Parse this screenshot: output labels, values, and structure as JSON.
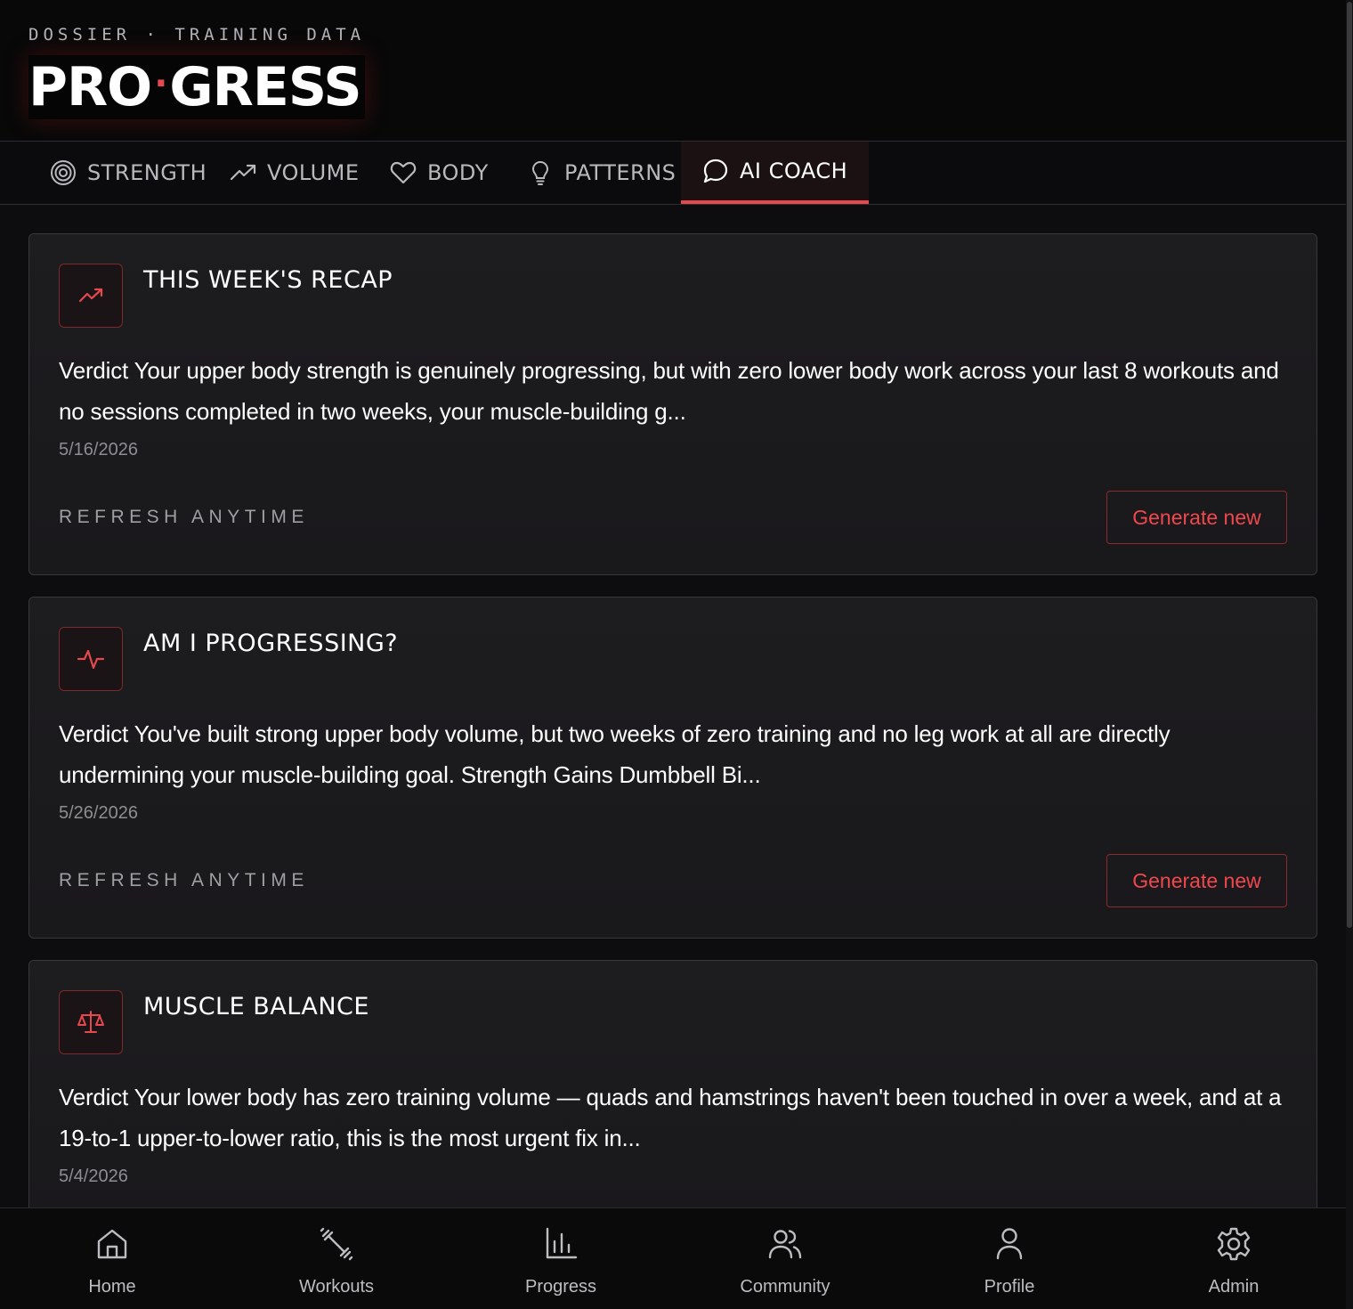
{
  "header": {
    "eyebrow": "DOSSIER · TRAINING DATA",
    "brand_left": "PRO",
    "brand_dot": "·",
    "brand_right": "GRESS"
  },
  "tabs": [
    {
      "label": "STRENGTH",
      "icon": "target-icon"
    },
    {
      "label": "VOLUME",
      "icon": "trending-up-icon"
    },
    {
      "label": "BODY",
      "icon": "heart-icon"
    },
    {
      "label": "PATTERNS",
      "icon": "lightbulb-icon"
    },
    {
      "label": "AI COACH",
      "icon": "chat-bubble-icon",
      "active": true
    }
  ],
  "cards": [
    {
      "title": "THIS WEEK'S RECAP",
      "icon": "trending-up-icon",
      "body": "Verdict Your upper body strength is genuinely progressing, but with zero lower body work across your last 8 workouts and no sessions completed in two weeks, your muscle-building g...",
      "date": "5/16/2026",
      "footer": "REFRESH ANYTIME",
      "button": "Generate new"
    },
    {
      "title": "AM I PROGRESSING?",
      "icon": "activity-pulse-icon",
      "body": "Verdict You've built strong upper body volume, but two weeks of zero training and no leg work at all are directly undermining your muscle-building goal. Strength Gains Dumbbell Bi...",
      "date": "5/26/2026",
      "footer": "REFRESH ANYTIME",
      "button": "Generate new"
    },
    {
      "title": "MUSCLE BALANCE",
      "icon": "scale-icon",
      "body": "Verdict Your lower body has zero training volume — quads and hamstrings haven't been touched in over a week, and at a 19-to-1 upper-to-lower ratio, this is the most urgent fix in...",
      "date": "5/4/2026"
    }
  ],
  "bottom_nav": [
    {
      "label": "Home",
      "icon": "home-icon"
    },
    {
      "label": "Workouts",
      "icon": "dumbbell-icon"
    },
    {
      "label": "Progress",
      "icon": "bar-chart-icon"
    },
    {
      "label": "Community",
      "icon": "users-icon"
    },
    {
      "label": "Profile",
      "icon": "user-icon"
    },
    {
      "label": "Admin",
      "icon": "gear-icon"
    }
  ],
  "colors": {
    "accent": "#e5484d",
    "background": "#0d0d0f",
    "card": "#1c1b1e"
  }
}
